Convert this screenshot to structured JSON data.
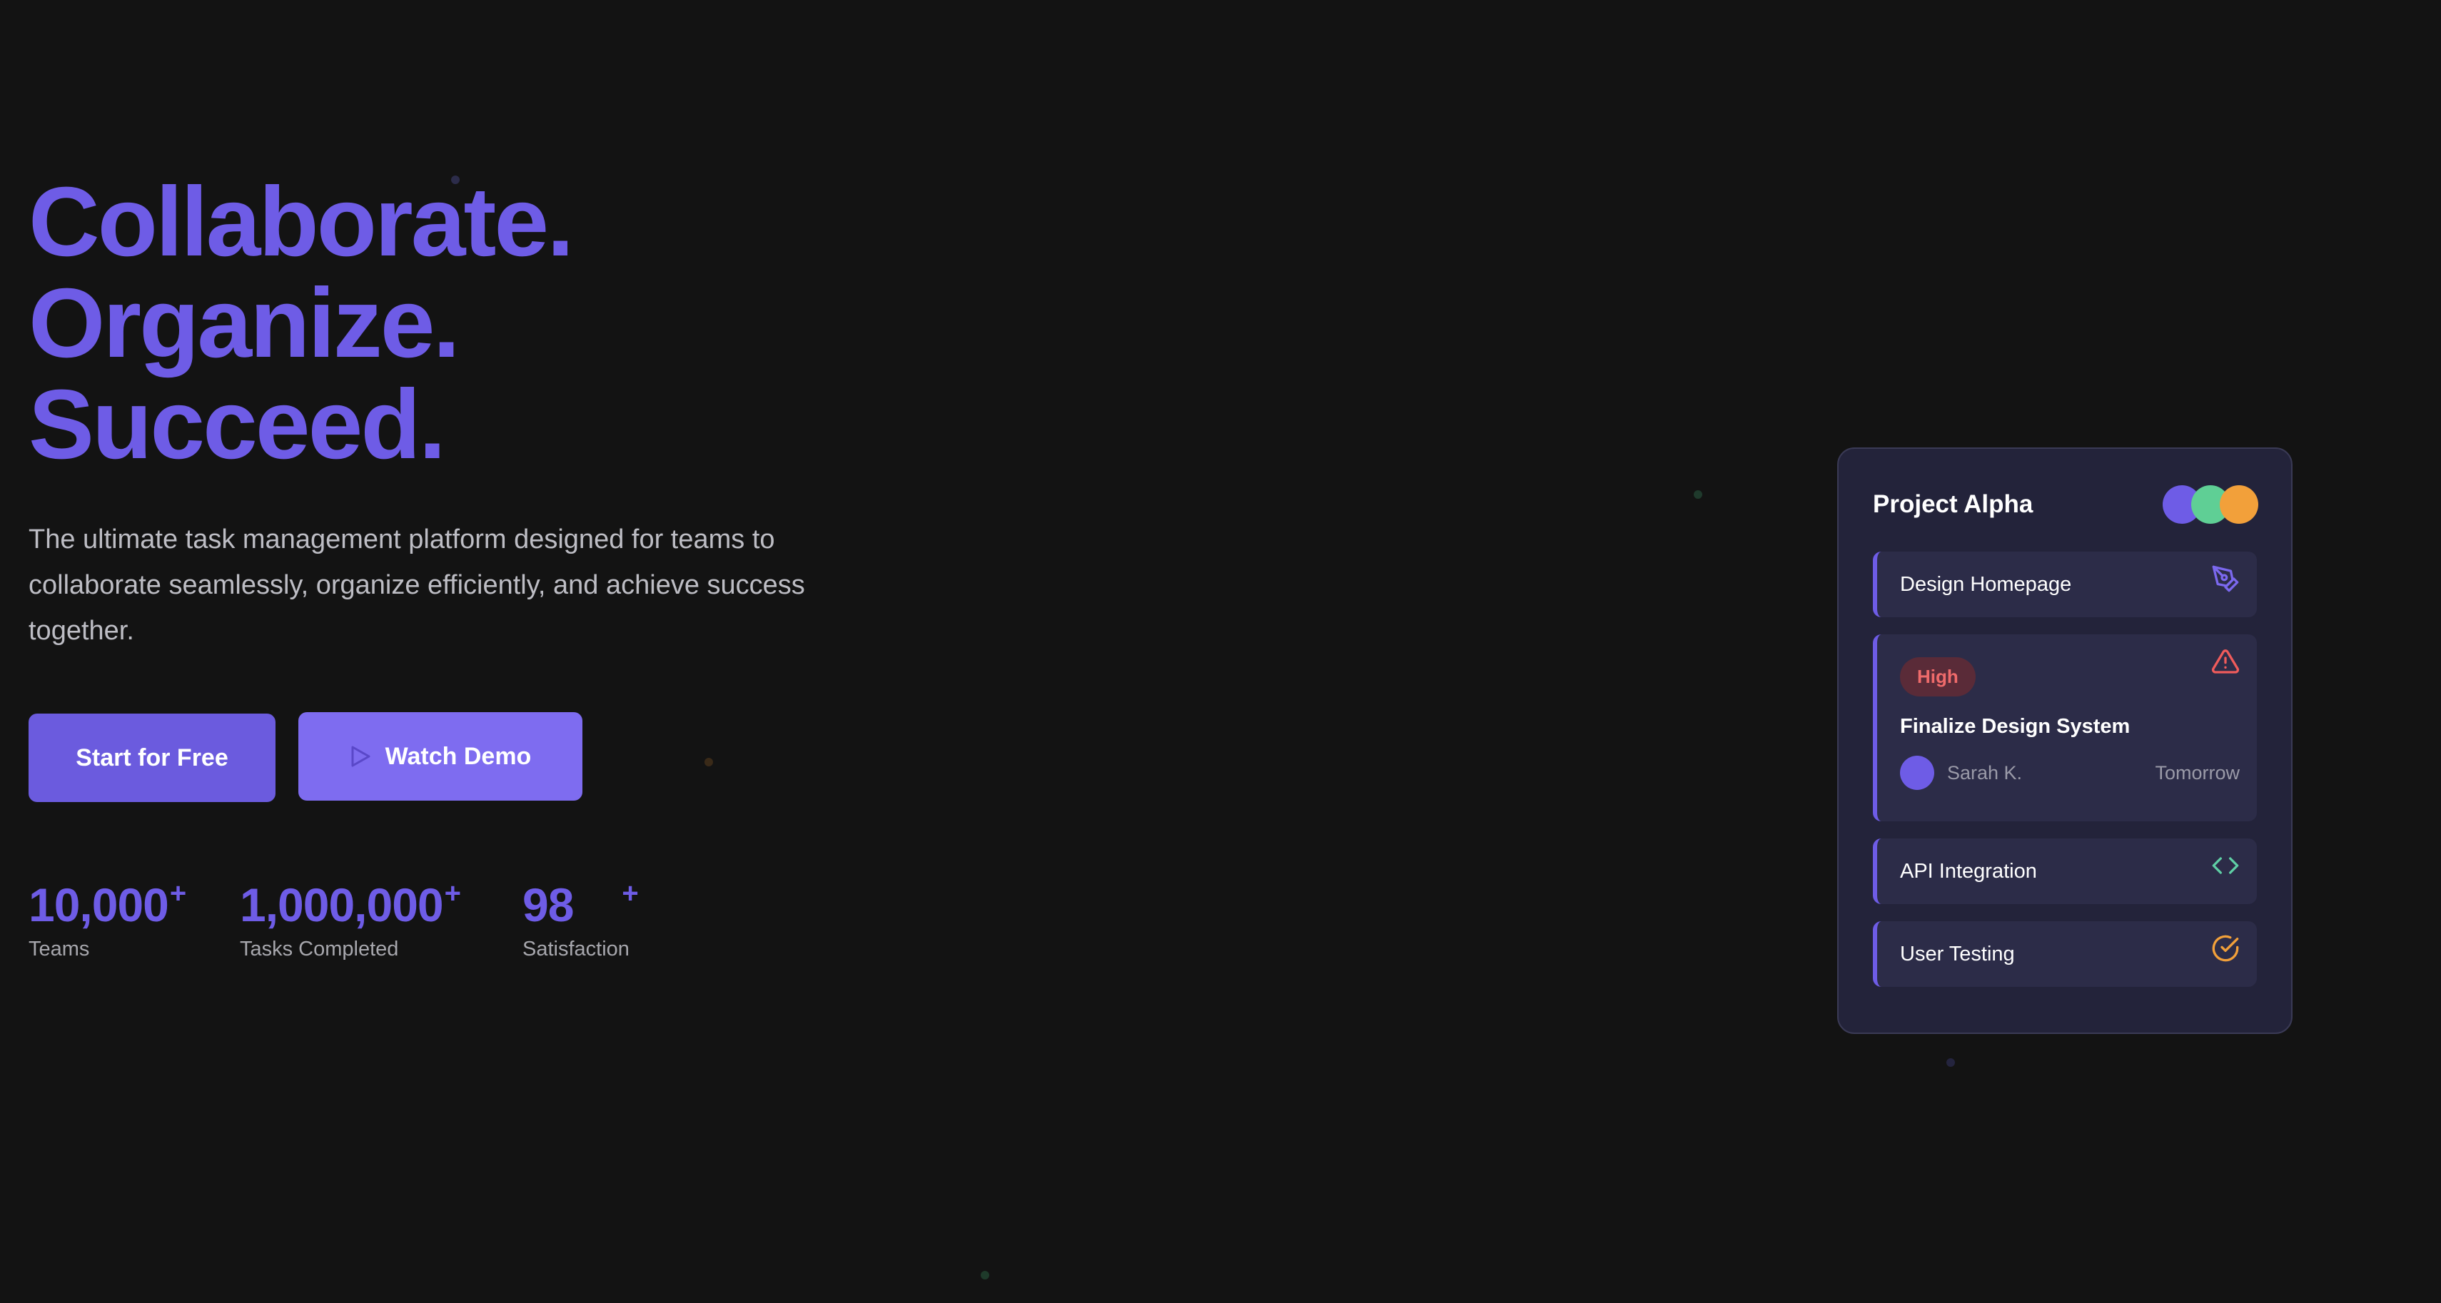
{
  "hero": {
    "headline": [
      "Collaborate.",
      "Organize.",
      "Succeed."
    ],
    "subtitle": "The ultimate task management platform designed for teams to collaborate seamlessly, organize efficiently, and achieve success together.",
    "primary_button": "Start for Free",
    "secondary_button": "Watch Demo",
    "secondary_button_icon": "play-icon"
  },
  "stats": [
    {
      "value": "10,000",
      "suffix": "+",
      "label": "Teams"
    },
    {
      "value": "1,000,000",
      "suffix": "+",
      "label": "Tasks Completed"
    },
    {
      "value": "98",
      "suffix": "+",
      "label": "Satisfaction"
    }
  ],
  "card": {
    "title": "Project Alpha",
    "avatar_colors": [
      "#6e5ce6",
      "#5fcf95",
      "#f2a03a"
    ],
    "tasks": [
      {
        "name": "Design Homepage",
        "icon": "pen-tool-icon",
        "icon_color": "#7b68ee"
      },
      {
        "priority": "High",
        "name": "Finalize Design System",
        "assignee": "Sarah K.",
        "due": "Tomorrow",
        "icon": "alert-triangle-icon",
        "icon_color": "#ef5b5b"
      },
      {
        "name": "API Integration",
        "icon": "code-icon",
        "icon_color": "#5fcfa5"
      },
      {
        "name": "User Testing",
        "icon": "check-circle-icon",
        "icon_color": "#f2a03a"
      }
    ]
  },
  "colors": {
    "background": "#131313",
    "accent": "#6e5ce6",
    "card_background": "#23233a"
  }
}
